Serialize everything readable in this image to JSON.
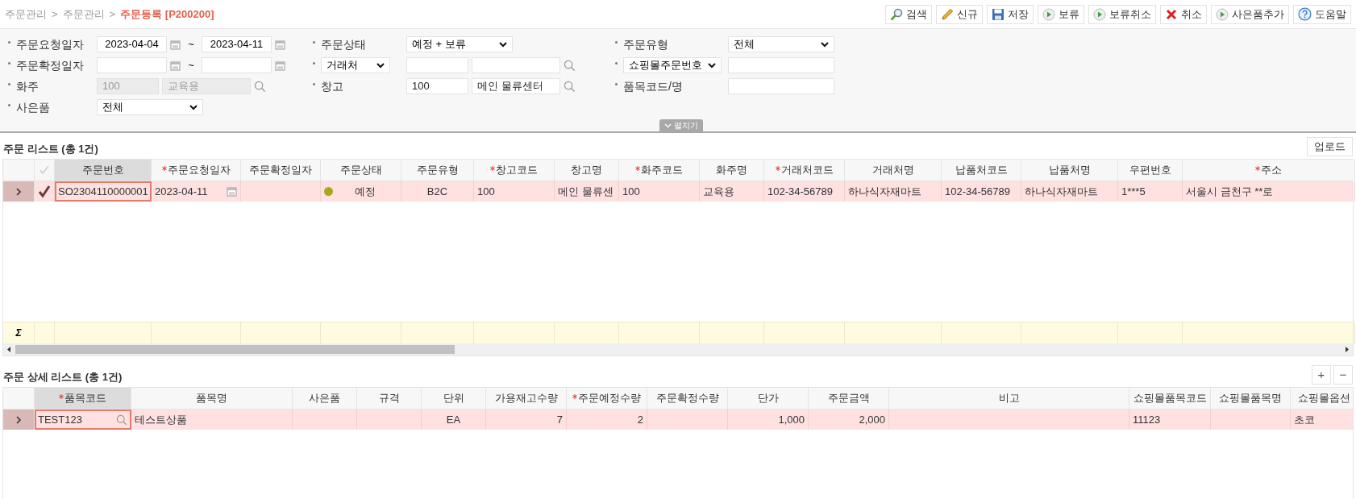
{
  "breadcrumb": {
    "items": [
      "주문관리",
      "주문관리"
    ],
    "separator": ">",
    "current": "주문등록 [P200200]"
  },
  "toolbar": [
    {
      "kind": "search",
      "label": "검색"
    },
    {
      "kind": "new",
      "label": "신규"
    },
    {
      "kind": "save",
      "label": "저장"
    },
    {
      "kind": "play",
      "label": "보류"
    },
    {
      "kind": "play",
      "label": "보류취소"
    },
    {
      "kind": "cancel",
      "label": "취소"
    },
    {
      "kind": "play",
      "label": "사은품추가"
    },
    {
      "kind": "help",
      "label": "도움말"
    }
  ],
  "filters": [
    [
      {
        "label": "주문요청일자",
        "kind": "text",
        "field": {
          "kind": "date_range",
          "from": "2023-04-04",
          "to": "2023-04-11",
          "separator": "~"
        }
      },
      {
        "label": "주문상태",
        "kind": "text",
        "field": {
          "kind": "select",
          "value": "예정 + 보류"
        }
      },
      {
        "label": "주문유형",
        "kind": "text",
        "field": {
          "kind": "select",
          "value": "전체"
        }
      }
    ],
    [
      {
        "label": "주문확정일자",
        "kind": "text",
        "field": {
          "kind": "date_range",
          "separator": "~"
        }
      },
      {
        "label": "거래처",
        "kind": "select",
        "field": {
          "kind": "lookup",
          "disabled": false
        }
      },
      {
        "label": "쇼핑몰주문번호",
        "kind": "select",
        "field": {
          "kind": "text"
        }
      }
    ],
    [
      {
        "label": "화주",
        "kind": "text",
        "field": {
          "kind": "lookup",
          "code": "100",
          "name": "교육용",
          "disabled": true
        }
      },
      {
        "label": "창고",
        "kind": "text",
        "field": {
          "kind": "lookup",
          "code": "100",
          "name": "메인 물류센터",
          "disabled": false
        }
      },
      {
        "label": "품목코드/명",
        "kind": "text",
        "field": {
          "kind": "text"
        }
      }
    ],
    [
      {
        "label": "사은품",
        "kind": "text",
        "field": {
          "kind": "select",
          "value": "전체"
        }
      }
    ]
  ],
  "expand_toggle": {
    "label": "펼치기",
    "expanded": false
  },
  "order_list": {
    "title": "주문 리스트 (총 1건)",
    "upload_button": "업로드",
    "columns": [
      {
        "label": "주문번호",
        "required": false,
        "kind": "text"
      },
      {
        "label": "주문요청일자",
        "required": true,
        "kind": "date"
      },
      {
        "label": "주문확정일자",
        "required": false,
        "kind": "text"
      },
      {
        "label": "주문상태",
        "required": false,
        "kind": "status"
      },
      {
        "label": "주문유형",
        "required": false,
        "kind": "text"
      },
      {
        "label": "창고코드",
        "required": true,
        "kind": "text"
      },
      {
        "label": "창고명",
        "required": false,
        "kind": "text"
      },
      {
        "label": "화주코드",
        "required": true,
        "kind": "text"
      },
      {
        "label": "화주명",
        "required": false,
        "kind": "text"
      },
      {
        "label": "거래처코드",
        "required": true,
        "kind": "text"
      },
      {
        "label": "거래처명",
        "required": false,
        "kind": "text"
      },
      {
        "label": "납품처코드",
        "required": false,
        "kind": "text"
      },
      {
        "label": "납품처명",
        "required": false,
        "kind": "text"
      },
      {
        "label": "우편번호",
        "required": false,
        "kind": "text"
      },
      {
        "label": "주소",
        "required": true,
        "kind": "text"
      }
    ],
    "all_checked": false,
    "rows": [
      {
        "selected": true,
        "checked": true,
        "cells": [
          {
            "text": "SO2304110000001",
            "focused": true
          },
          {
            "text": "2023-04-11",
            "focused": false
          },
          {
            "focused": false
          },
          {
            "text": "예정",
            "color": "#a8a820",
            "focused": false
          },
          {
            "text": "B2C",
            "focused": false
          },
          {
            "text": "100",
            "focused": false
          },
          {
            "text": "메인 물류센",
            "focused": false
          },
          {
            "text": "100",
            "focused": false
          },
          {
            "text": "교육용",
            "focused": false
          },
          {
            "text": "102-34-56789",
            "focused": false
          },
          {
            "text": "하나식자재마트",
            "focused": false
          },
          {
            "text": "102-34-56789",
            "focused": false
          },
          {
            "text": "하나식자재마트",
            "focused": false
          },
          {
            "text": "1***5",
            "focused": false
          },
          {
            "text": "서울시 금천구 **로",
            "focused": false
          }
        ]
      }
    ],
    "summary_mark": "Σ"
  },
  "detail_list": {
    "title": "주문 상세 리스트 (총 1건)",
    "add_button": "+",
    "remove_button": "−",
    "columns": [
      {
        "label": "품목코드",
        "required": true,
        "kind": "lookup"
      },
      {
        "label": "품목명",
        "required": false,
        "kind": "text"
      },
      {
        "label": "사은품",
        "required": false,
        "kind": "text"
      },
      {
        "label": "규격",
        "required": false,
        "kind": "text"
      },
      {
        "label": "단위",
        "required": false,
        "kind": "text"
      },
      {
        "label": "가용재고수량",
        "required": false,
        "kind": "text"
      },
      {
        "label": "주문예정수량",
        "required": true,
        "kind": "text"
      },
      {
        "label": "주문확정수량",
        "required": false,
        "kind": "text"
      },
      {
        "label": "단가",
        "required": false,
        "kind": "text"
      },
      {
        "label": "주문금액",
        "required": false,
        "kind": "text"
      },
      {
        "label": "비고",
        "required": false,
        "kind": "text"
      },
      {
        "label": "쇼핑몰품목코드",
        "required": false,
        "kind": "text"
      },
      {
        "label": "쇼핑몰품목명",
        "required": false,
        "kind": "text"
      },
      {
        "label": "쇼핑몰옵션",
        "required": false,
        "kind": "text"
      }
    ],
    "rows": [
      {
        "selected": true,
        "cells": [
          {
            "text": "TEST123",
            "focused": true
          },
          {
            "text": "테스트상품",
            "focused": false
          },
          {
            "focused": false
          },
          {
            "focused": false
          },
          {
            "text": "EA",
            "focused": false
          },
          {
            "text": "7",
            "focused": false
          },
          {
            "text": "2",
            "focused": false
          },
          {
            "focused": false
          },
          {
            "text": "1,000",
            "focused": false
          },
          {
            "text": "2,000",
            "focused": false
          },
          {
            "focused": false
          },
          {
            "text": "11123",
            "focused": false
          },
          {
            "focused": false
          },
          {
            "text": "초코",
            "focused": false
          }
        ]
      }
    ]
  }
}
